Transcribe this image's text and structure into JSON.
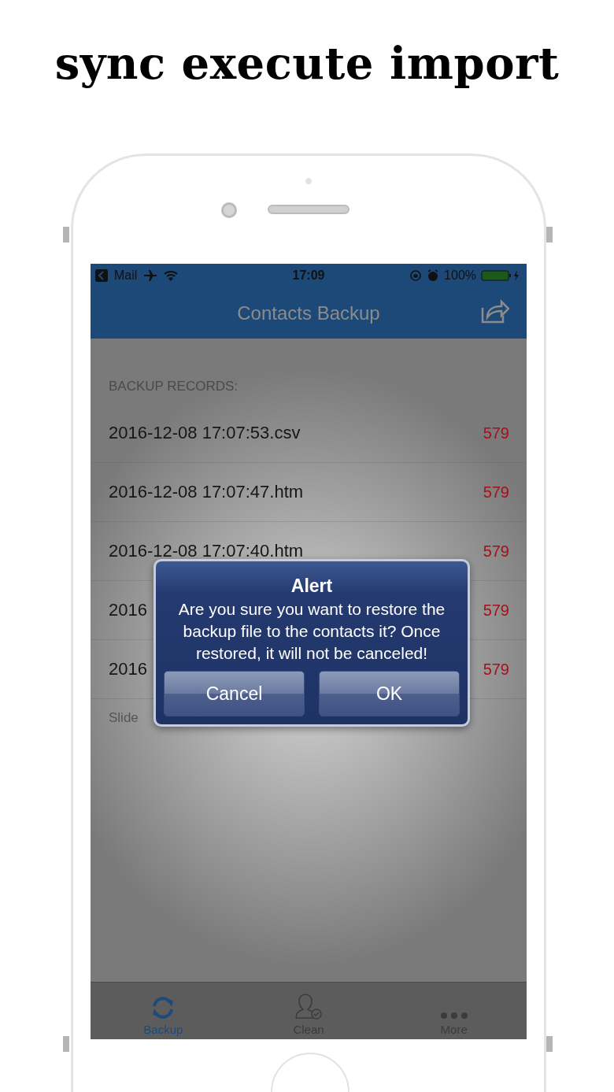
{
  "headline": "sync execute import",
  "status_bar": {
    "back_label": "Mail",
    "time": "17:09",
    "battery": "100%"
  },
  "nav": {
    "title": "Contacts Backup"
  },
  "section_header": "BACKUP RECORDS:",
  "records": [
    {
      "name": "2016-12-08 17:07:53.csv",
      "count": "579"
    },
    {
      "name": "2016-12-08 17:07:47.htm",
      "count": "579"
    },
    {
      "name": "2016-12-08 17:07:40.htm",
      "count": "579"
    },
    {
      "name": "2016",
      "count": "579"
    },
    {
      "name": "2016",
      "count": "579"
    }
  ],
  "footer": "Slide",
  "alert": {
    "title": "Alert",
    "message": "Are you sure you want to restore the backup file to the contacts it? Once restored, it will not be canceled!",
    "buttons": [
      "Cancel",
      "OK"
    ]
  },
  "tabs": [
    {
      "label": "Backup",
      "kind": "sync",
      "selected": true
    },
    {
      "label": "Clean",
      "kind": "person",
      "selected": false
    },
    {
      "label": "More",
      "kind": "dots",
      "selected": false
    }
  ]
}
